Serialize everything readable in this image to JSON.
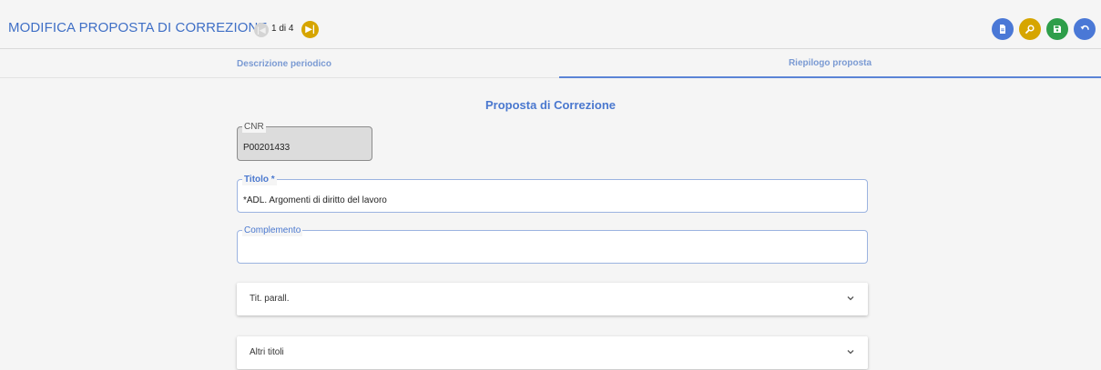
{
  "header": {
    "title": "MODIFICA PROPOSTA DI CORREZIONE",
    "pager": "1 di 4",
    "actions": [
      {
        "name": "document-icon",
        "color": "#4a78d6"
      },
      {
        "name": "search-icon",
        "color": "#d6a500"
      },
      {
        "name": "save-icon",
        "color": "#2e9e4a"
      },
      {
        "name": "undo-icon",
        "color": "#4a78d6"
      }
    ]
  },
  "tabs": [
    {
      "label": "Descrizione periodico",
      "active": false
    },
    {
      "label": "Riepilogo proposta",
      "active": true
    }
  ],
  "form": {
    "title": "Proposta di Correzione",
    "cnr": {
      "label": "CNR",
      "value": "P00201433"
    },
    "titolo": {
      "label": "Titolo *",
      "value": "*ADL. Argomenti di diritto del lavoro"
    },
    "complemento": {
      "label": "Complemento",
      "value": ""
    },
    "accordions": [
      {
        "label": "Tit. parall."
      },
      {
        "label": "Altri titoli"
      }
    ]
  }
}
